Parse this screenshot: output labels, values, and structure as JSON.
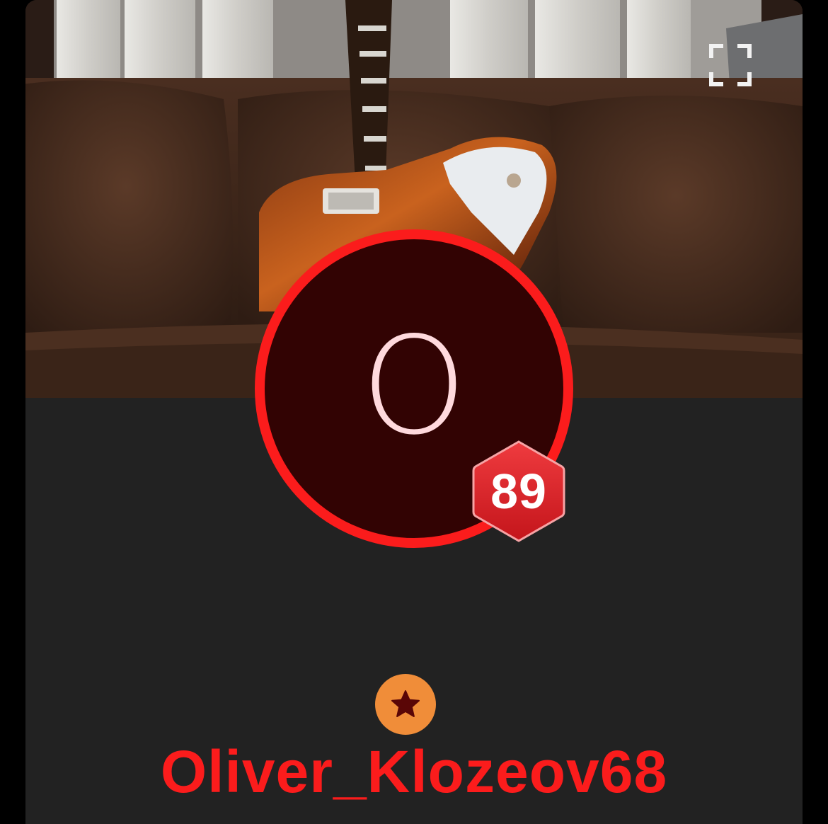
{
  "profile": {
    "avatar_letter": "O",
    "level": "89",
    "username": "Oliver_Klozeov68"
  },
  "cover": {
    "description_icon": "guitar-on-couch-photo"
  },
  "icons": {
    "expand": "fullscreen-expand-icon",
    "rank": "star-icon",
    "level_badge": "hexagon-badge-icon"
  },
  "colors": {
    "accent": "#fb1c1c",
    "avatar_bg": "#320303",
    "avatar_letter": "#ffd9dd",
    "card_bg": "#222222",
    "rank_bg": "#f08d39",
    "rank_star": "#5a0606",
    "badge_fill": "#e0262b"
  }
}
